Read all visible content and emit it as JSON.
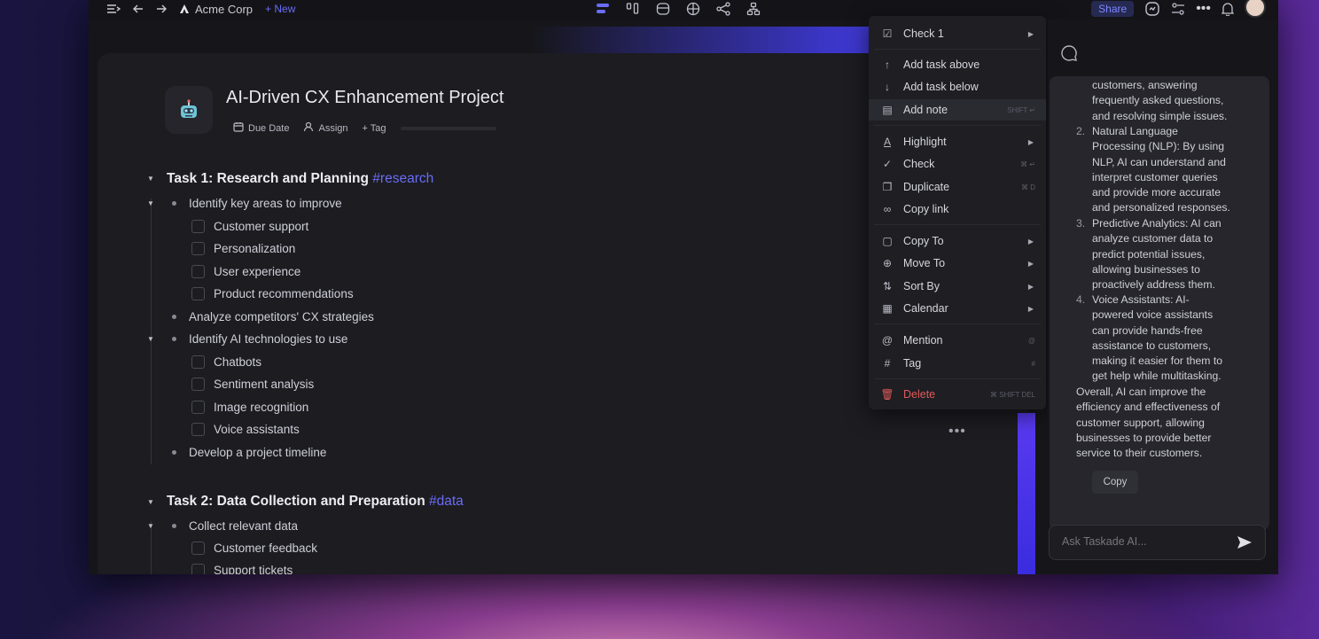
{
  "topbar": {
    "workspace": "Acme Corp",
    "new_label": "+ New",
    "share_label": "Share"
  },
  "project": {
    "title": "AI-Driven CX Enhancement Project",
    "meta": {
      "due": "Due Date",
      "assign": "Assign",
      "tag": "+ Tag"
    }
  },
  "tasks": {
    "t1": {
      "title": "Task 1: Research and Planning",
      "tag": "#research"
    },
    "t1_items": [
      "Identify key areas to improve",
      "Customer support",
      "Personalization",
      "User experience",
      "Product recommendations",
      "Analyze competitors' CX strategies",
      "Identify AI technologies to use",
      "Chatbots",
      "Sentiment analysis",
      "Image recognition",
      "Voice assistants",
      "Develop a project timeline"
    ],
    "t2": {
      "title": "Task 2: Data Collection and Preparation",
      "tag": "#data"
    },
    "t2_items": [
      "Collect relevant data",
      "Customer feedback",
      "Support tickets"
    ]
  },
  "menu": {
    "check1": "Check 1",
    "add_above": "Add task above",
    "add_below": "Add task below",
    "add_note": "Add note",
    "add_note_kbd": "SHIFT ↵",
    "highlight": "Highlight",
    "check": "Check",
    "check_kbd": "⌘ ↵",
    "duplicate": "Duplicate",
    "duplicate_kbd": "⌘ D",
    "copy_link": "Copy link",
    "copy_to": "Copy To",
    "move_to": "Move To",
    "sort_by": "Sort By",
    "calendar": "Calendar",
    "mention": "Mention",
    "mention_kbd": "@",
    "tag": "Tag",
    "tag_kbd": "#",
    "delete": "Delete",
    "delete_kbd": "⌘ SHIFT DEL"
  },
  "ai": {
    "intro": [
      "customers, answering",
      "frequently asked questions,",
      "and resolving simple issues."
    ],
    "points": [
      {
        "num": "2.",
        "lines": [
          "Natural Language",
          "Processing (NLP): By using",
          "NLP, AI can understand and",
          "interpret customer queries",
          "and provide more accurate",
          "and personalized responses."
        ]
      },
      {
        "num": "3.",
        "lines": [
          "Predictive Analytics: AI can",
          "analyze customer data to",
          "predict potential issues,",
          "allowing businesses to",
          "proactively address them."
        ]
      },
      {
        "num": "4.",
        "lines": [
          "Voice Assistants: AI-",
          "powered voice assistants",
          "can provide hands-free",
          "assistance to customers,",
          "making it easier for them to",
          "get help while multitasking."
        ]
      }
    ],
    "summary": [
      "Overall, AI can improve the",
      "efficiency and effectiveness of",
      "customer support, allowing",
      "businesses to provide better",
      "service to their customers."
    ],
    "copy_label": "Copy",
    "ask_placeholder": "Ask Taskade AI..."
  },
  "colors": {
    "accent": "#6b6cf6",
    "danger": "#e05a5a",
    "background": "#16161a"
  }
}
